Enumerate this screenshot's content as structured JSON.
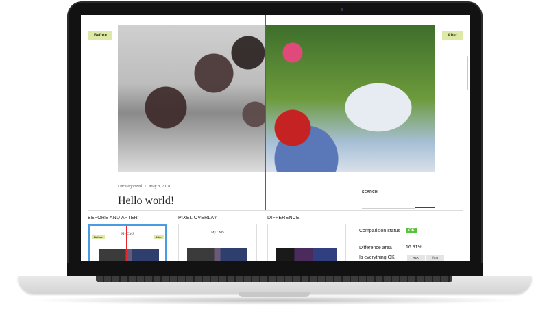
{
  "site": {
    "before_label": "Before",
    "after_label": "After",
    "category": "Uncategorized",
    "separator": "/",
    "date": "May 8, 2018",
    "post_title": "Hello world!",
    "search_label": "SEARCH"
  },
  "panel": {
    "headings": [
      "BEFORE AND AFTER",
      "PIXEL OVERLAY",
      "DIFFERENCE"
    ],
    "thumb_site_title": "My CMS",
    "thumb_before_tag": "Before",
    "thumb_after_tag": "After"
  },
  "stats": {
    "status_label": "Comparision status",
    "status_value": "OK",
    "area_label": "Difference area",
    "area_value": "16.91%",
    "ok_question": "Is everything OK",
    "yes_label": "Yes",
    "no_label": "No"
  },
  "colors": {
    "split_line": "#e5262a",
    "tag_background": "#dfe9a6",
    "ok_badge": "#5cc043",
    "active_thumb_border": "#4a9be2"
  }
}
